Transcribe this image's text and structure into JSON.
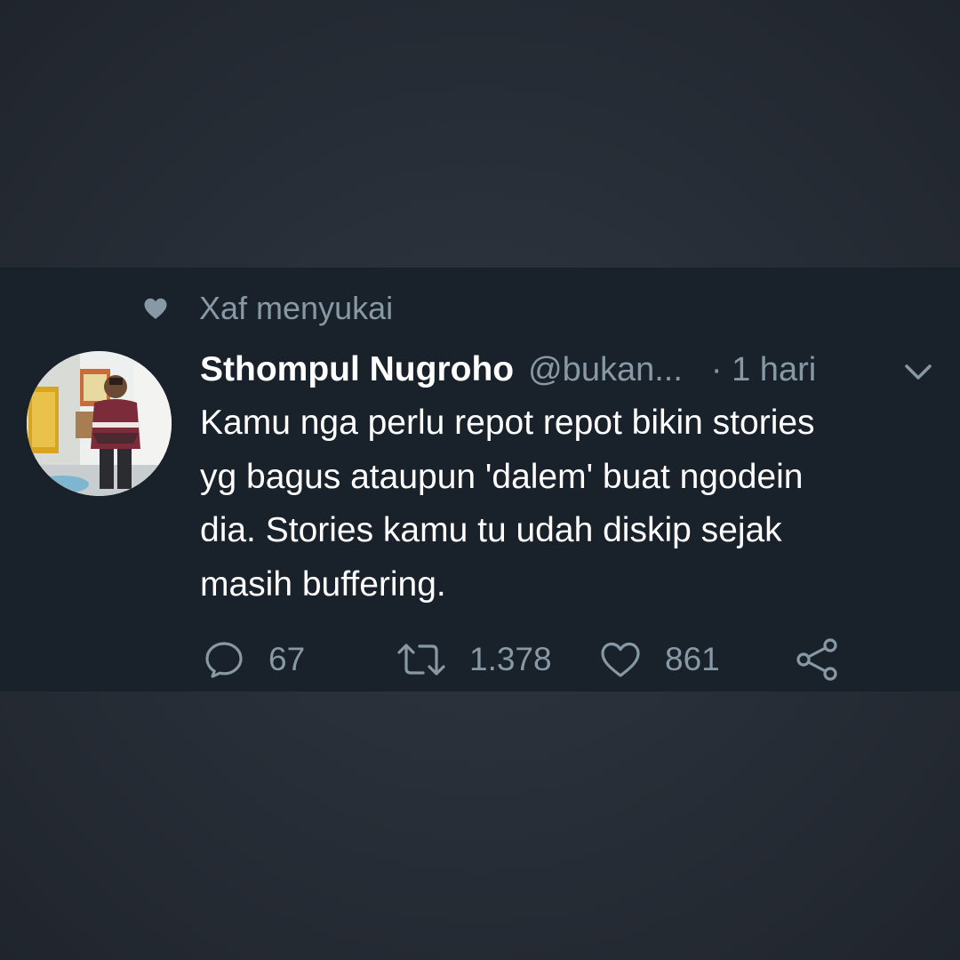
{
  "social_context": {
    "icon": "heart-icon",
    "text": "Xaf menyukai"
  },
  "tweet": {
    "author_name": "Sthompul Nugroho",
    "handle": "@bukan...",
    "time": "· 1 hari",
    "lines": [
      "Kamu nga perlu repot repot bikin stories",
      "yg bagus ataupun 'dalem' buat ngodein",
      "dia. Stories kamu tu udah diskip sejak",
      "masih buffering."
    ]
  },
  "actions": {
    "replies": "67",
    "retweets": "1.378",
    "likes": "861"
  },
  "colors": {
    "background": "#272d36",
    "card": "#19212b",
    "muted": "#8899a6",
    "text": "#ffffff"
  }
}
